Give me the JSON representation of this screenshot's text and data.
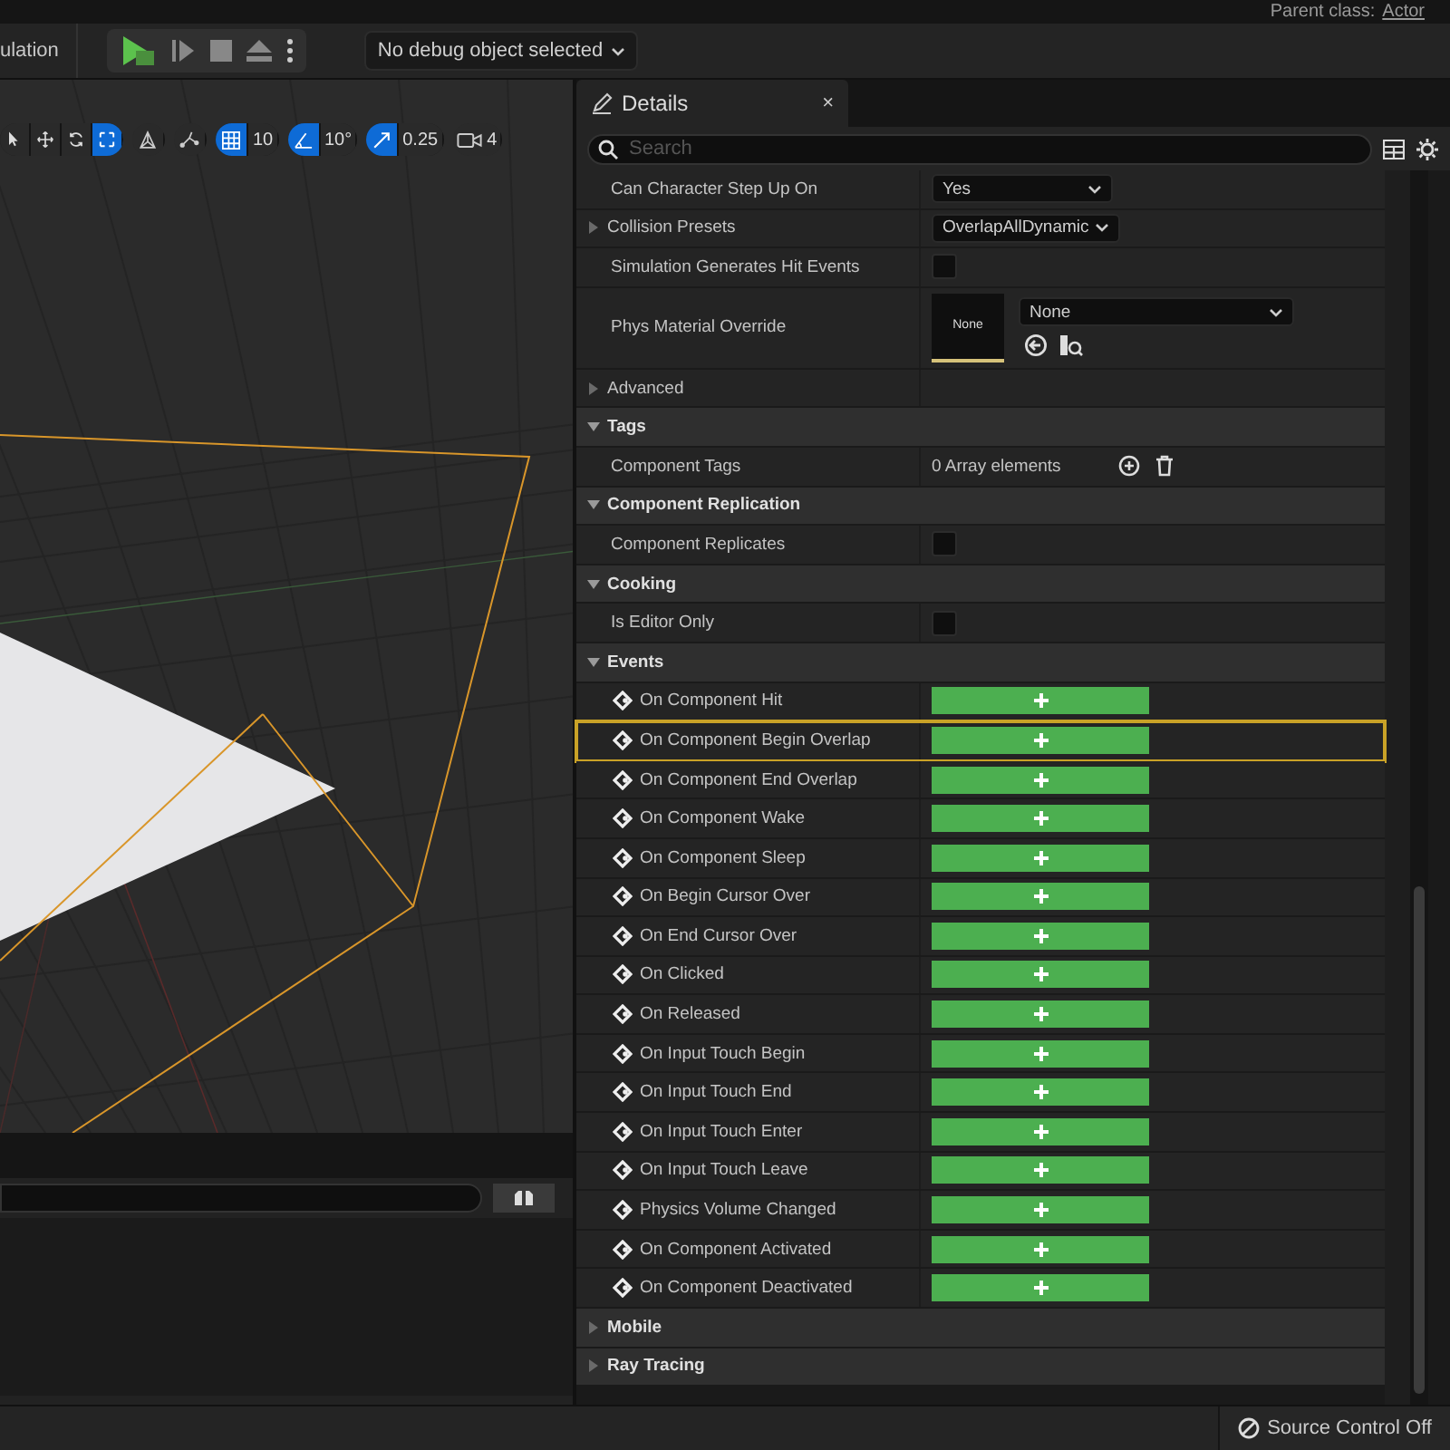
{
  "header": {
    "parent_label": "Parent class:",
    "parent_value": "Actor"
  },
  "toolbar": {
    "mode_text": "ulation",
    "debug_dropdown": "No debug object selected"
  },
  "viewport_toolbar": {
    "transform_tools": [
      {
        "kind": "select",
        "selected": false
      },
      {
        "kind": "move",
        "selected": false
      },
      {
        "kind": "rotate",
        "selected": false
      },
      {
        "kind": "scale",
        "selected": true
      }
    ],
    "grid_snap": {
      "on": true,
      "value": "10"
    },
    "rotation_snap": {
      "on": true,
      "value": "10°"
    },
    "scale_snap": {
      "on": true,
      "value": "0.25"
    },
    "camera_speed": "4"
  },
  "details": {
    "tab": "Details",
    "close": "×",
    "search": {
      "placeholder": "Search"
    },
    "rows": [
      {
        "kind": "dropdown",
        "label": "Can Character Step Up On",
        "value": "Yes"
      },
      {
        "kind": "dropdown",
        "label": "Collision Presets",
        "value": "OverlapAllDynamic",
        "expandable": true
      },
      {
        "kind": "checkbox",
        "label": "Simulation Generates Hit Events",
        "checked": false
      },
      {
        "kind": "material",
        "label": "Phys Material Override",
        "thumb": "None",
        "value": "None"
      },
      {
        "kind": "group",
        "label": "Advanced",
        "expanded": false
      },
      {
        "kind": "section",
        "label": "Tags",
        "expanded": true
      },
      {
        "kind": "array",
        "label": "Component Tags",
        "value": "0 Array elements"
      },
      {
        "kind": "section",
        "label": "Component Replication",
        "expanded": true
      },
      {
        "kind": "checkbox",
        "label": "Component Replicates",
        "checked": false
      },
      {
        "kind": "section",
        "label": "Cooking",
        "expanded": true
      },
      {
        "kind": "checkbox",
        "label": "Is Editor Only",
        "checked": false
      },
      {
        "kind": "section",
        "label": "Events",
        "expanded": true
      },
      {
        "kind": "event",
        "label": "On Component Hit",
        "selected": false
      },
      {
        "kind": "event",
        "label": "On Component Begin Overlap",
        "selected": true
      },
      {
        "kind": "event",
        "label": "On Component End Overlap",
        "selected": false
      },
      {
        "kind": "event",
        "label": "On Component Wake",
        "selected": false
      },
      {
        "kind": "event",
        "label": "On Component Sleep",
        "selected": false
      },
      {
        "kind": "event",
        "label": "On Begin Cursor Over",
        "selected": false
      },
      {
        "kind": "event",
        "label": "On End Cursor Over",
        "selected": false
      },
      {
        "kind": "event",
        "label": "On Clicked",
        "selected": false
      },
      {
        "kind": "event",
        "label": "On Released",
        "selected": false
      },
      {
        "kind": "event",
        "label": "On Input Touch Begin",
        "selected": false
      },
      {
        "kind": "event",
        "label": "On Input Touch End",
        "selected": false
      },
      {
        "kind": "event",
        "label": "On Input Touch Enter",
        "selected": false
      },
      {
        "kind": "event",
        "label": "On Input Touch Leave",
        "selected": false
      },
      {
        "kind": "event",
        "label": "Physics Volume Changed",
        "selected": false
      },
      {
        "kind": "event",
        "label": "On Component Activated",
        "selected": false
      },
      {
        "kind": "event",
        "label": "On Component Deactivated",
        "selected": false
      },
      {
        "kind": "section",
        "label": "Mobile",
        "expanded": false
      },
      {
        "kind": "section",
        "label": "Ray Tracing",
        "expanded": false
      }
    ]
  },
  "status_bar": {
    "source_control": "Source Control Off"
  }
}
